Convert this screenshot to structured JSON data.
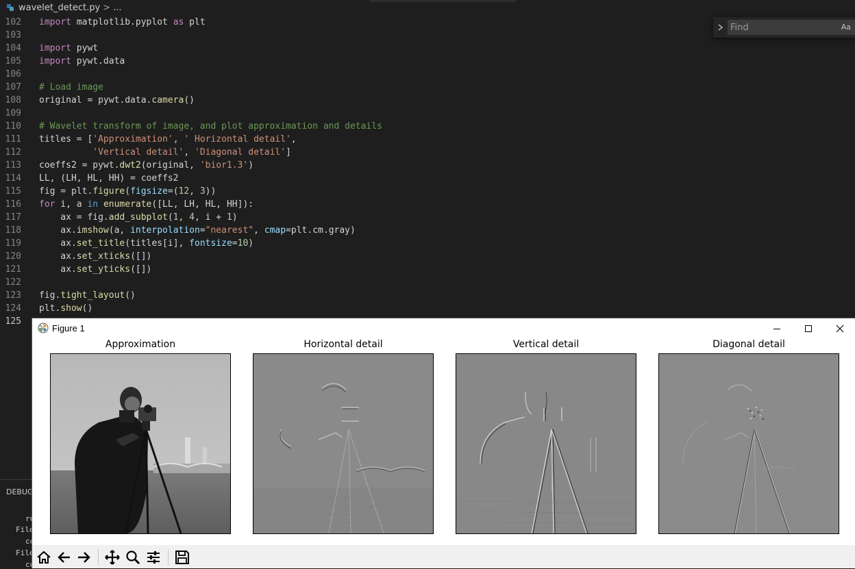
{
  "editor": {
    "breadcrumb": {
      "file": "wavelet_detect.py",
      "separator": ">",
      "more": "..."
    },
    "lines": [
      {
        "n": "102"
      },
      {
        "n": "103"
      },
      {
        "n": "104"
      },
      {
        "n": "105"
      },
      {
        "n": "106"
      },
      {
        "n": "107"
      },
      {
        "n": "108"
      },
      {
        "n": "109"
      },
      {
        "n": "110"
      },
      {
        "n": "111"
      },
      {
        "n": "112"
      },
      {
        "n": "113"
      },
      {
        "n": "114"
      },
      {
        "n": "115"
      },
      {
        "n": "116"
      },
      {
        "n": "117"
      },
      {
        "n": "118"
      },
      {
        "n": "119"
      },
      {
        "n": "120"
      },
      {
        "n": "121"
      },
      {
        "n": "122"
      },
      {
        "n": "123"
      },
      {
        "n": "124"
      },
      {
        "n": "125"
      }
    ],
    "code": {
      "l102_kw": "import",
      "l102_rest": " matplotlib.pyplot ",
      "l102_as": "as",
      "l102_alias": " plt",
      "l104_kw": "import",
      "l104_rest": " pywt",
      "l105_kw": "import",
      "l105_rest": " pywt.data",
      "l107": "# Load image",
      "l108_a": "original = pywt.data.",
      "l108_fn": "camera",
      "l108_b": "()",
      "l110": "# Wavelet transform of image, and plot approximation and details",
      "l111_a": "titles = [",
      "l111_s1": "'Approximation'",
      "l111_c": ", ",
      "l111_s2": "' Horizontal detail'",
      "l111_d": ",",
      "l112_indent": "          ",
      "l112_s1": "'Vertical detail'",
      "l112_c": ", ",
      "l112_s2": "'Diagonal detail'",
      "l112_d": "]",
      "l113_a": "coeffs2 = pywt.",
      "l113_fn": "dwt2",
      "l113_b": "(original, ",
      "l113_s": "'bior1.3'",
      "l113_c": ")",
      "l114": "LL, (LH, HL, HH) = coeffs2",
      "l115_a": "fig = plt.",
      "l115_fn": "figure",
      "l115_b": "(",
      "l115_p": "figsize",
      "l115_c": "=(",
      "l115_n1": "12",
      "l115_d": ", ",
      "l115_n2": "3",
      "l115_e": "))",
      "l116_for": "for",
      "l116_a": " i, a ",
      "l116_in": "in",
      "l116_sp": " ",
      "l116_fn": "enumerate",
      "l116_b": "([LL, LH, HL, HH]):",
      "l117_a": "    ax = fig.",
      "l117_fn": "add_subplot",
      "l117_b": "(",
      "l117_n1": "1",
      "l117_c": ", ",
      "l117_n2": "4",
      "l117_d": ", i + ",
      "l117_n3": "1",
      "l117_e": ")",
      "l118_a": "    ax.",
      "l118_fn": "imshow",
      "l118_b": "(a, ",
      "l118_p1": "interpolation",
      "l118_c": "=",
      "l118_s": "\"nearest\"",
      "l118_d": ", ",
      "l118_p2": "cmap",
      "l118_e": "=plt.cm.gray)",
      "l119_a": "    ax.",
      "l119_fn": "set_title",
      "l119_b": "(titles[i], ",
      "l119_p": "fontsize",
      "l119_c": "=",
      "l119_n": "10",
      "l119_d": ")",
      "l120_a": "    ax.",
      "l120_fn": "set_xticks",
      "l120_b": "([])",
      "l121_a": "    ax.",
      "l121_fn": "set_yticks",
      "l121_b": "([])",
      "l123_a": "fig.",
      "l123_fn": "tight_layout",
      "l123_b": "()",
      "l124_a": "plt.",
      "l124_fn": "show",
      "l124_b": "()"
    }
  },
  "find_widget": {
    "placeholder": "Find",
    "match_case": "Aa"
  },
  "debug_panel": {
    "label": "DEBUG",
    "lines": [
      "ru",
      "File",
      "co",
      "File",
      "co"
    ]
  },
  "figure_window": {
    "title": "Figure 1",
    "subplots": [
      {
        "title": "Approximation"
      },
      {
        "title": "Horizontal detail"
      },
      {
        "title": "Vertical detail"
      },
      {
        "title": "Diagonal detail"
      }
    ]
  },
  "colors": {
    "editor_bg": "#1e1e1e",
    "keyword": "#c586c0",
    "string": "#ce9178",
    "comment": "#6a9955",
    "function": "#dcdcaa",
    "number": "#b5cea8",
    "param": "#9cdcfe"
  }
}
